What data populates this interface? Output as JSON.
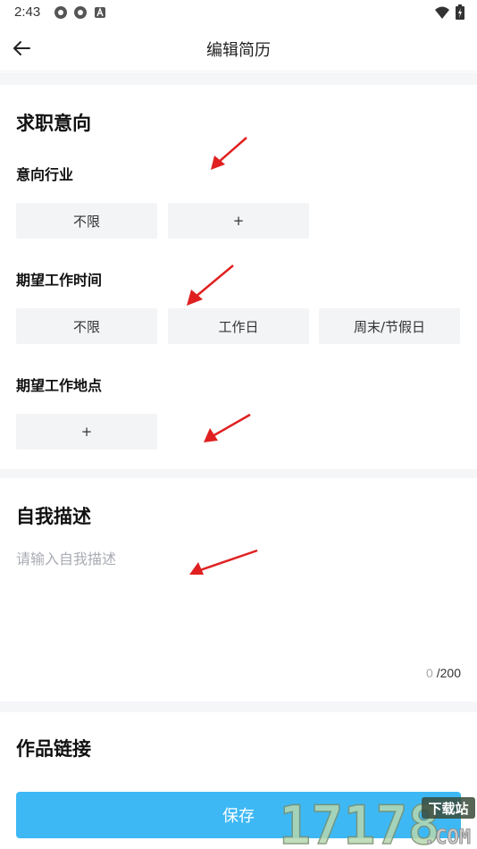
{
  "status_bar": {
    "time": "2:43"
  },
  "header": {
    "title": "编辑简历"
  },
  "job_intention": {
    "title": "求职意向",
    "industry": {
      "label": "意向行业",
      "options": [
        "不限",
        "+"
      ]
    },
    "work_time": {
      "label": "期望工作时间",
      "options": [
        "不限",
        "工作日",
        "周末/节假日"
      ]
    },
    "work_location": {
      "label": "期望工作地点",
      "options": [
        "+"
      ]
    }
  },
  "self_description": {
    "title": "自我描述",
    "placeholder": "请输入自我描述",
    "count_current": "0",
    "count_max": "/200"
  },
  "portfolio": {
    "title": "作品链接"
  },
  "footer": {
    "save_label": "保存"
  },
  "watermark": {
    "number": "17178",
    "site_tag": "下载站",
    "domain": ".COM"
  },
  "colors": {
    "accent": "#3db8f5",
    "chip_bg": "#f3f4f6",
    "annotation_arrow": "#e02020"
  }
}
